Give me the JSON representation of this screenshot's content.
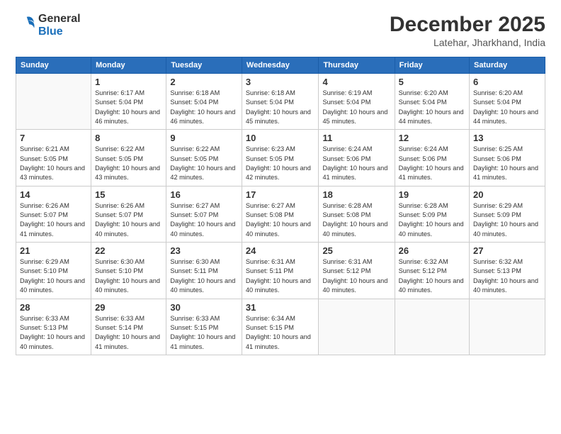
{
  "logo": {
    "general": "General",
    "blue": "Blue"
  },
  "title": "December 2025",
  "location": "Latehar, Jharkhand, India",
  "days_header": [
    "Sunday",
    "Monday",
    "Tuesday",
    "Wednesday",
    "Thursday",
    "Friday",
    "Saturday"
  ],
  "weeks": [
    [
      {
        "day": "",
        "info": ""
      },
      {
        "day": "1",
        "info": "Sunrise: 6:17 AM\nSunset: 5:04 PM\nDaylight: 10 hours\nand 46 minutes."
      },
      {
        "day": "2",
        "info": "Sunrise: 6:18 AM\nSunset: 5:04 PM\nDaylight: 10 hours\nand 46 minutes."
      },
      {
        "day": "3",
        "info": "Sunrise: 6:18 AM\nSunset: 5:04 PM\nDaylight: 10 hours\nand 45 minutes."
      },
      {
        "day": "4",
        "info": "Sunrise: 6:19 AM\nSunset: 5:04 PM\nDaylight: 10 hours\nand 45 minutes."
      },
      {
        "day": "5",
        "info": "Sunrise: 6:20 AM\nSunset: 5:04 PM\nDaylight: 10 hours\nand 44 minutes."
      },
      {
        "day": "6",
        "info": "Sunrise: 6:20 AM\nSunset: 5:04 PM\nDaylight: 10 hours\nand 44 minutes."
      }
    ],
    [
      {
        "day": "7",
        "info": "Sunrise: 6:21 AM\nSunset: 5:05 PM\nDaylight: 10 hours\nand 43 minutes."
      },
      {
        "day": "8",
        "info": "Sunrise: 6:22 AM\nSunset: 5:05 PM\nDaylight: 10 hours\nand 43 minutes."
      },
      {
        "day": "9",
        "info": "Sunrise: 6:22 AM\nSunset: 5:05 PM\nDaylight: 10 hours\nand 42 minutes."
      },
      {
        "day": "10",
        "info": "Sunrise: 6:23 AM\nSunset: 5:05 PM\nDaylight: 10 hours\nand 42 minutes."
      },
      {
        "day": "11",
        "info": "Sunrise: 6:24 AM\nSunset: 5:06 PM\nDaylight: 10 hours\nand 41 minutes."
      },
      {
        "day": "12",
        "info": "Sunrise: 6:24 AM\nSunset: 5:06 PM\nDaylight: 10 hours\nand 41 minutes."
      },
      {
        "day": "13",
        "info": "Sunrise: 6:25 AM\nSunset: 5:06 PM\nDaylight: 10 hours\nand 41 minutes."
      }
    ],
    [
      {
        "day": "14",
        "info": "Sunrise: 6:26 AM\nSunset: 5:07 PM\nDaylight: 10 hours\nand 41 minutes."
      },
      {
        "day": "15",
        "info": "Sunrise: 6:26 AM\nSunset: 5:07 PM\nDaylight: 10 hours\nand 40 minutes."
      },
      {
        "day": "16",
        "info": "Sunrise: 6:27 AM\nSunset: 5:07 PM\nDaylight: 10 hours\nand 40 minutes."
      },
      {
        "day": "17",
        "info": "Sunrise: 6:27 AM\nSunset: 5:08 PM\nDaylight: 10 hours\nand 40 minutes."
      },
      {
        "day": "18",
        "info": "Sunrise: 6:28 AM\nSunset: 5:08 PM\nDaylight: 10 hours\nand 40 minutes."
      },
      {
        "day": "19",
        "info": "Sunrise: 6:28 AM\nSunset: 5:09 PM\nDaylight: 10 hours\nand 40 minutes."
      },
      {
        "day": "20",
        "info": "Sunrise: 6:29 AM\nSunset: 5:09 PM\nDaylight: 10 hours\nand 40 minutes."
      }
    ],
    [
      {
        "day": "21",
        "info": "Sunrise: 6:29 AM\nSunset: 5:10 PM\nDaylight: 10 hours\nand 40 minutes."
      },
      {
        "day": "22",
        "info": "Sunrise: 6:30 AM\nSunset: 5:10 PM\nDaylight: 10 hours\nand 40 minutes."
      },
      {
        "day": "23",
        "info": "Sunrise: 6:30 AM\nSunset: 5:11 PM\nDaylight: 10 hours\nand 40 minutes."
      },
      {
        "day": "24",
        "info": "Sunrise: 6:31 AM\nSunset: 5:11 PM\nDaylight: 10 hours\nand 40 minutes."
      },
      {
        "day": "25",
        "info": "Sunrise: 6:31 AM\nSunset: 5:12 PM\nDaylight: 10 hours\nand 40 minutes."
      },
      {
        "day": "26",
        "info": "Sunrise: 6:32 AM\nSunset: 5:12 PM\nDaylight: 10 hours\nand 40 minutes."
      },
      {
        "day": "27",
        "info": "Sunrise: 6:32 AM\nSunset: 5:13 PM\nDaylight: 10 hours\nand 40 minutes."
      }
    ],
    [
      {
        "day": "28",
        "info": "Sunrise: 6:33 AM\nSunset: 5:13 PM\nDaylight: 10 hours\nand 40 minutes."
      },
      {
        "day": "29",
        "info": "Sunrise: 6:33 AM\nSunset: 5:14 PM\nDaylight: 10 hours\nand 41 minutes."
      },
      {
        "day": "30",
        "info": "Sunrise: 6:33 AM\nSunset: 5:15 PM\nDaylight: 10 hours\nand 41 minutes."
      },
      {
        "day": "31",
        "info": "Sunrise: 6:34 AM\nSunset: 5:15 PM\nDaylight: 10 hours\nand 41 minutes."
      },
      {
        "day": "",
        "info": ""
      },
      {
        "day": "",
        "info": ""
      },
      {
        "day": "",
        "info": ""
      }
    ]
  ]
}
